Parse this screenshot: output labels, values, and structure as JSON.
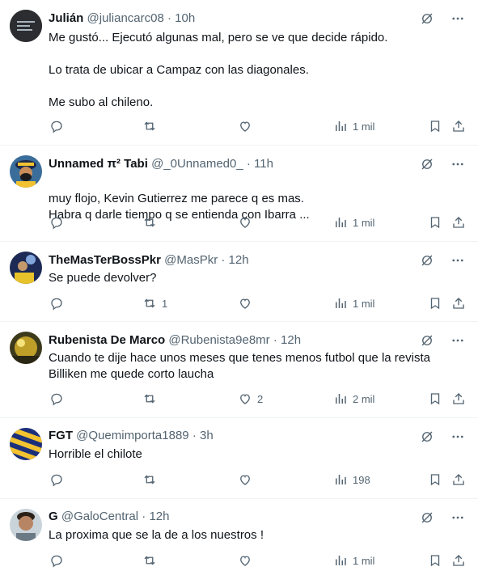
{
  "tweets": [
    {
      "name": "Julián",
      "handle": "@juliancarc08",
      "separator": "·",
      "time": "10h",
      "paragraphs": [
        "Me gustó... Ejecutó algunas mal, pero se ve que decide rápido.",
        "Lo trata de ubicar a Campaz con las diagonales.",
        "Me subo al chileno."
      ],
      "replies": "",
      "reposts": "",
      "likes": "",
      "views": "1 mil",
      "avatar_bg": "#2b2d31"
    },
    {
      "name": "Unnamed π² Tabi",
      "handle": "@_0Unnamed0_",
      "separator": "·",
      "time": "11h",
      "paragraphs": [
        "muy flojo, Kevin Gutierrez me parece q es mas.\nHabra q darle tiempo q se entienda con Ibarra ..."
      ],
      "replies": "",
      "reposts": "",
      "likes": "",
      "views": "1 mil",
      "avatar_bg": "#3a6d9a"
    },
    {
      "name": "TheMasTerBossPkr",
      "handle": "@MasPkr",
      "separator": "·",
      "time": "12h",
      "paragraphs": [
        "Se puede devolver?"
      ],
      "replies": "",
      "reposts": "1",
      "likes": "",
      "views": "1 mil",
      "avatar_bg": "#1c2a55"
    },
    {
      "name": "Rubenista De Marco",
      "handle": "@Rubenista9e8mr",
      "separator": "·",
      "time": "12h",
      "paragraphs": [
        "Cuando te dije hace unos meses que tenes menos futbol que la revista Billiken me quede corto laucha"
      ],
      "replies": "",
      "reposts": "",
      "likes": "2",
      "views": "2 mil",
      "avatar_bg": "#8a7a2a"
    },
    {
      "name": "FGT",
      "handle": "@Quemimporta1889",
      "separator": "·",
      "time": "3h",
      "paragraphs": [
        "Horrible el chilote"
      ],
      "replies": "",
      "reposts": "",
      "likes": "",
      "views": "198",
      "avatar_bg": "#1b2f7a"
    },
    {
      "name": "G",
      "handle": "@GaloCentral",
      "separator": "·",
      "time": "12h",
      "paragraphs": [
        "La proxima que se la de a los nuestros !"
      ],
      "replies": "",
      "reposts": "",
      "likes": "",
      "views": "1 mil",
      "avatar_bg": "#c9d3da"
    }
  ],
  "icons": {
    "grok": "grok-icon",
    "more": "more-icon",
    "reply": "reply-icon",
    "repost": "repost-icon",
    "like": "like-icon",
    "views": "views-icon",
    "bookmark": "bookmark-icon",
    "share": "share-icon"
  },
  "colors": {
    "text": "#0f1419",
    "muted": "#536471",
    "divider": "#eff3f4"
  }
}
